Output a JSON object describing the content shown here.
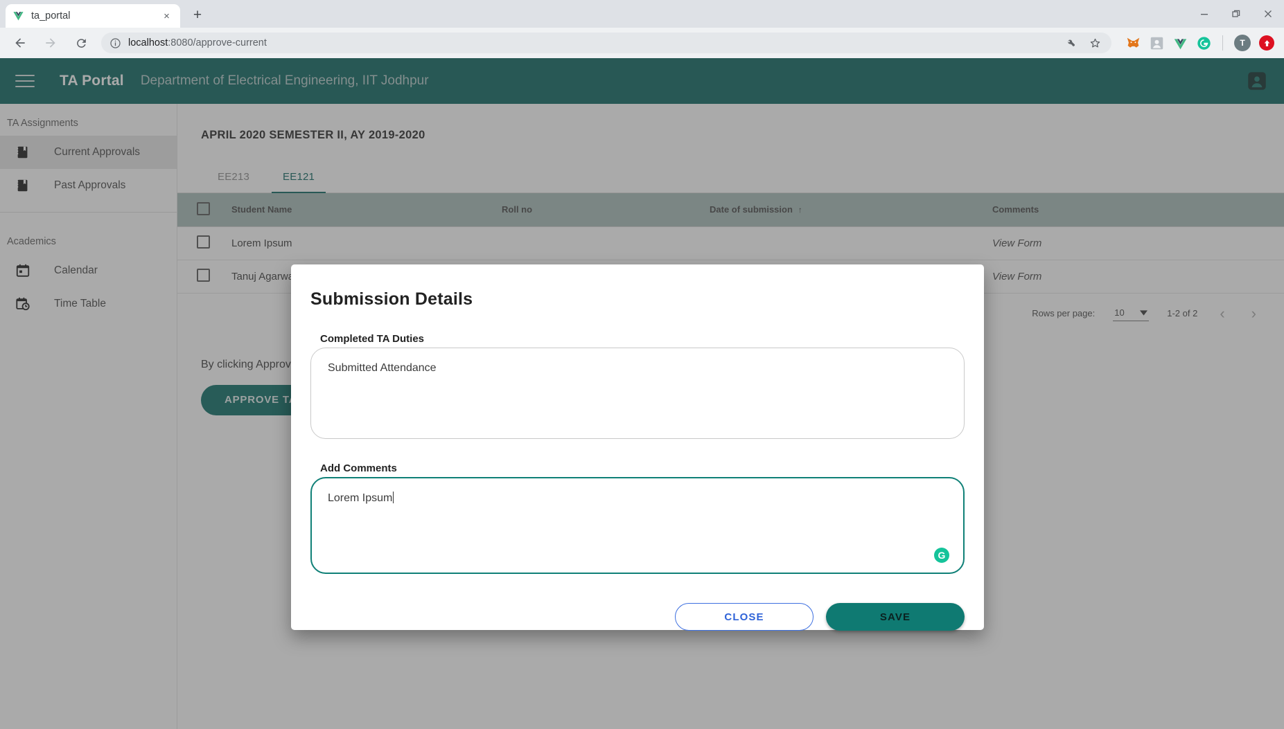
{
  "browser": {
    "tab": {
      "title": "ta_portal",
      "favicon": "vue-logo-icon",
      "close": "×"
    },
    "new_tab_label": "+",
    "window_controls": {
      "minimize": "–",
      "maximize": "❐",
      "close": "✕"
    },
    "nav": {
      "back": "←",
      "forward": "→",
      "reload": "↻"
    },
    "omnibox": {
      "host": "localhost",
      "path": ":8080/approve-current",
      "info_icon": "site-info-icon",
      "password_icon": "key-icon",
      "bookmark_icon": "star-icon"
    },
    "extensions": [
      {
        "name": "metamask-icon",
        "glyph": "🦊"
      },
      {
        "name": "generic-extension-icon",
        "glyph": ""
      },
      {
        "name": "vue-devtools-icon",
        "glyph": "V"
      },
      {
        "name": "grammarly-icon",
        "glyph": "G"
      }
    ],
    "profile_initial": "T",
    "update_icon": "update-available-icon"
  },
  "appbar": {
    "menu_icon": "hamburger-menu-icon",
    "brand": "TA Portal",
    "department": "Department of Electrical Engineering, IIT Jodhpur",
    "account_icon": "account-circle-icon"
  },
  "sidebar": {
    "sections": [
      {
        "caption": "TA Assignments",
        "items": [
          {
            "label": "Current Approvals",
            "icon": "book-icon",
            "active": true
          },
          {
            "label": "Past Approvals",
            "icon": "book-icon",
            "active": false
          }
        ]
      },
      {
        "caption": "Academics",
        "items": [
          {
            "label": "Calendar",
            "icon": "calendar-icon",
            "active": false
          },
          {
            "label": "Time Table",
            "icon": "schedule-icon",
            "active": false
          }
        ]
      }
    ]
  },
  "main": {
    "page_title": "APRIL 2020 SEMESTER II, AY 2019-2020",
    "tabs": [
      {
        "label": "EE213",
        "active": false
      },
      {
        "label": "EE121",
        "active": true
      }
    ],
    "table": {
      "columns": [
        "Student Name",
        "Roll no",
        "Date of submission",
        "Comments"
      ],
      "sort_column": "Date of submission",
      "sort_arrow": "↑",
      "rows": [
        {
          "student_name": "Lorem Ipsum",
          "roll_no": "",
          "date_of_submission": "",
          "comments": "View Form"
        },
        {
          "student_name": "Tanuj Agarwal",
          "roll_no": "",
          "date_of_submission": "",
          "comments": "View Form"
        }
      ]
    },
    "paginator": {
      "rows_per_page_label": "Rows per page:",
      "rows_per_page_value": "10",
      "range_label": "1-2 of 2",
      "prev_icon": "‹",
      "next_icon": "›"
    },
    "approve_note": "By clicking Approve,",
    "approve_button": "APPROVE TA REL"
  },
  "modal": {
    "title": "Submission Details",
    "duties_label": "Completed TA Duties",
    "duties_value": "Submitted Attendance",
    "comments_label": "Add Comments",
    "comments_value": "Lorem Ipsum",
    "comments_placeholder": "",
    "grammarly_badge": "G",
    "close_button": "CLOSE",
    "save_button": "SAVE"
  },
  "colors": {
    "brand_teal": "#106862",
    "accent_teal": "#0f8077",
    "link_blue": "#2f63d8",
    "table_header": "#a9bcba",
    "grammarly_green": "#15c39a"
  }
}
